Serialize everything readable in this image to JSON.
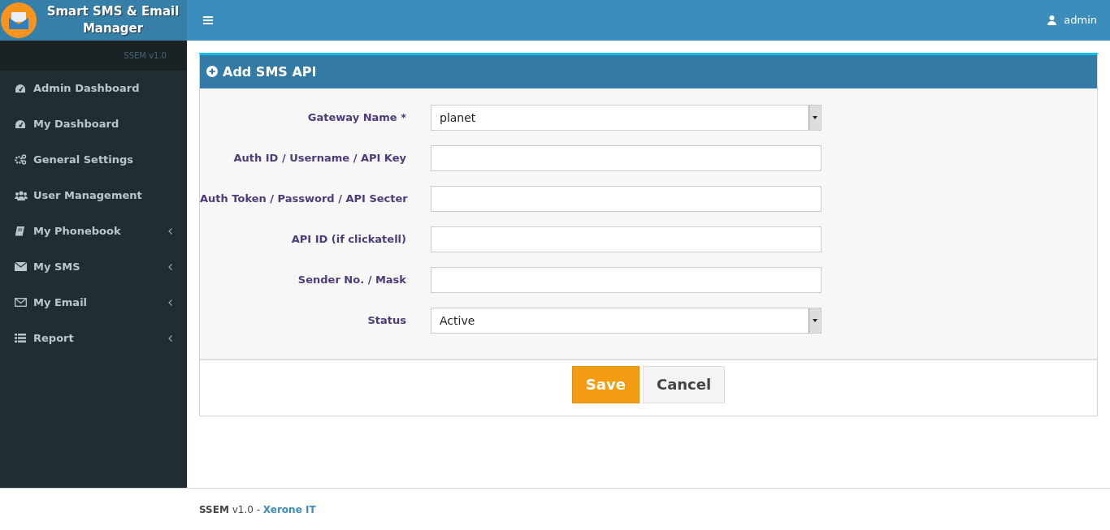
{
  "brand": {
    "title": "Smart SMS & Email Manager",
    "version": "SSEM v1.0"
  },
  "navbar": {
    "user": "admin"
  },
  "sidebar": {
    "items": [
      {
        "label": "Admin Dashboard",
        "has_submenu": false
      },
      {
        "label": "My Dashboard",
        "has_submenu": false
      },
      {
        "label": "General Settings",
        "has_submenu": false
      },
      {
        "label": "User Management",
        "has_submenu": false
      },
      {
        "label": "My Phonebook",
        "has_submenu": true
      },
      {
        "label": "My SMS",
        "has_submenu": true
      },
      {
        "label": "My Email",
        "has_submenu": true
      },
      {
        "label": "Report",
        "has_submenu": true
      }
    ]
  },
  "form": {
    "title": "Add SMS API",
    "fields": [
      {
        "label": "Gateway Name *",
        "kind": "select",
        "value": "planet"
      },
      {
        "label": "Auth ID / Username / API Key",
        "kind": "text"
      },
      {
        "label": "Auth Token / Password / API Secter",
        "kind": "text"
      },
      {
        "label": "API ID (if clickatell)",
        "kind": "text"
      },
      {
        "label": "Sender No. / Mask",
        "kind": "text"
      },
      {
        "label": "Status",
        "kind": "select",
        "value": "Active"
      }
    ],
    "buttons": [
      {
        "label": "Save",
        "kind": "primary"
      },
      {
        "label": "Cancel",
        "kind": "default"
      }
    ]
  },
  "footer": {
    "text": "**SSEM** v1.0 - ",
    "link": "Xerone IT"
  }
}
